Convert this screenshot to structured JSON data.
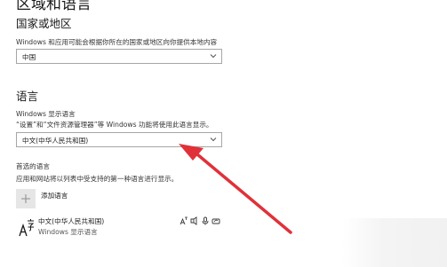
{
  "page": {
    "title": "区域和语言"
  },
  "region": {
    "heading": "国家或地区",
    "description": "Windows 和应用可能会根据你所在的国家或地区向你提供本地内容",
    "selected": "中国"
  },
  "language": {
    "heading": "语言",
    "display_label": "Windows 显示语言",
    "display_note": "“设置”和“文件资源管理器”等 Windows 功能将使用此语言显示。",
    "display_selected": "中文(中华人民共和国)",
    "preferred_heading": "首选的语言",
    "preferred_note": "应用和网站将以列表中受支持的第一种语言进行显示。",
    "add_label": "添加语言",
    "items": [
      {
        "name": "中文(中华人民共和国)",
        "sub": "Windows 显示语言",
        "icon": "language-char-icon",
        "features": [
          "display-language-icon",
          "speech-icon",
          "microphone-icon",
          "handwriting-icon"
        ]
      }
    ]
  },
  "annotation": {
    "arrow_color": "#e0313a"
  }
}
